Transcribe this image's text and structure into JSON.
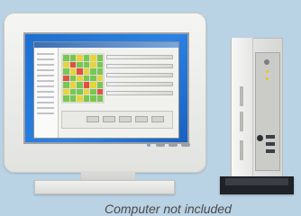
{
  "caption": "Computer not included",
  "colors": {
    "background": "#b9d2e4",
    "desktop": "#2b83e3",
    "heatmap_green": "#78c850",
    "heatmap_yellow": "#e6d43a",
    "heatmap_red": "#e0523f"
  },
  "icons": {
    "monitor": "monitor-icon",
    "tower": "computer-tower-icon"
  },
  "heatmap": [
    [
      "g",
      "g",
      "y",
      "g",
      "y",
      "g"
    ],
    [
      "y",
      "r",
      "g",
      "g",
      "y",
      "g"
    ],
    [
      "g",
      "y",
      "r",
      "y",
      "g",
      "g"
    ],
    [
      "r",
      "g",
      "y",
      "g",
      "g",
      "y"
    ],
    [
      "g",
      "y",
      "g",
      "r",
      "y",
      "g"
    ],
    [
      "y",
      "g",
      "g",
      "y",
      "g",
      "r"
    ],
    [
      "g",
      "g",
      "y",
      "g",
      "g",
      "g"
    ]
  ]
}
